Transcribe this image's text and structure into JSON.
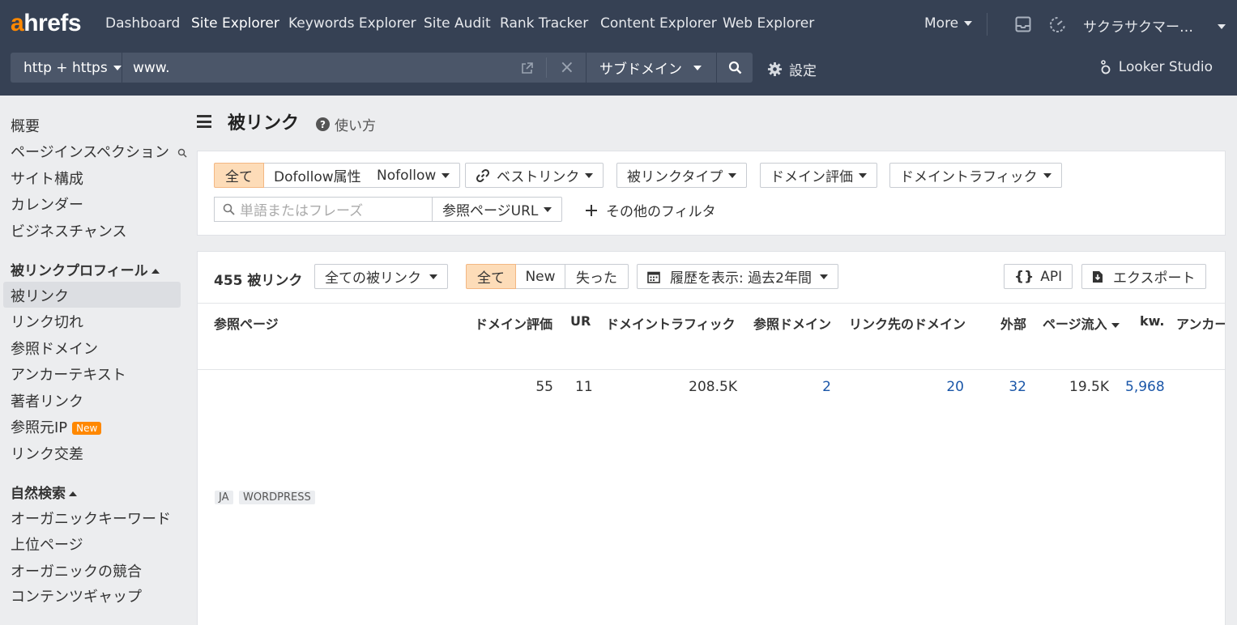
{
  "brand": {
    "logo_a": "a",
    "logo_rest": "hrefs",
    "accent": "#ff8800",
    "nav_bg": "#364154"
  },
  "nav": {
    "items": [
      "Dashboard",
      "Site Explorer",
      "Keywords Explorer",
      "Site Audit",
      "Rank Tracker",
      "Content Explorer",
      "Web Explorer"
    ],
    "more": "More",
    "account": "サクラサクマー…"
  },
  "search": {
    "protocol": "http + https",
    "url": "www.",
    "mode": "サブドメイン",
    "settings": "設定",
    "looker": "Looker Studio"
  },
  "sidebar": {
    "group1": [
      "概要",
      "ページインスペクション",
      "サイト構成",
      "カレンダー",
      "ビジネスチャンス"
    ],
    "backlink_header": "被リンクプロフィール",
    "backlink_items": [
      "被リンク",
      "リンク切れ",
      "参照ドメイン",
      "アンカーテキスト",
      "著者リンク",
      "参照元IP",
      "リンク交差"
    ],
    "new_badge": "New",
    "organic_header": "自然検索",
    "organic_items": [
      "オーガニックキーワード",
      "上位ページ",
      "オーガニックの競合",
      "コンテンツギャップ"
    ]
  },
  "page": {
    "title": "被リンク",
    "help": "使い方"
  },
  "filters": {
    "all": "全て",
    "dofollow": "Dofollow属性",
    "nofollow": "Nofollow",
    "best_link": "ベストリンク",
    "link_type": "被リンクタイプ",
    "domain_rating": "ドメイン評価",
    "domain_traffic": "ドメイントラフィック",
    "search_placeholder": "単語またはフレーズ",
    "ref_page_url": "参照ページURL",
    "more_filters": "その他のフィルタ"
  },
  "table": {
    "count": "455 被リンク",
    "all_backlinks": "全ての被リンク",
    "seg_all": "全て",
    "seg_new": "New",
    "seg_lost": "失った",
    "history": "履歴を表示: 過去2年間",
    "api": "API",
    "export": "エクスポート",
    "headers": [
      "参照ページ",
      "ドメイン評価",
      "UR",
      "ドメイントラフィック",
      "参照ドメイン",
      "リンク先のドメイン",
      "外部",
      "ページ流入",
      "kw.",
      "アンカー"
    ],
    "row": {
      "dr": "55",
      "ur": "11",
      "traffic": "208.5K",
      "ref_domains": "2",
      "linked_domains": "20",
      "external": "32",
      "page_traffic": "19.5K",
      "kw": "5,968"
    },
    "tags": [
      "JA",
      "WORDPRESS"
    ]
  }
}
